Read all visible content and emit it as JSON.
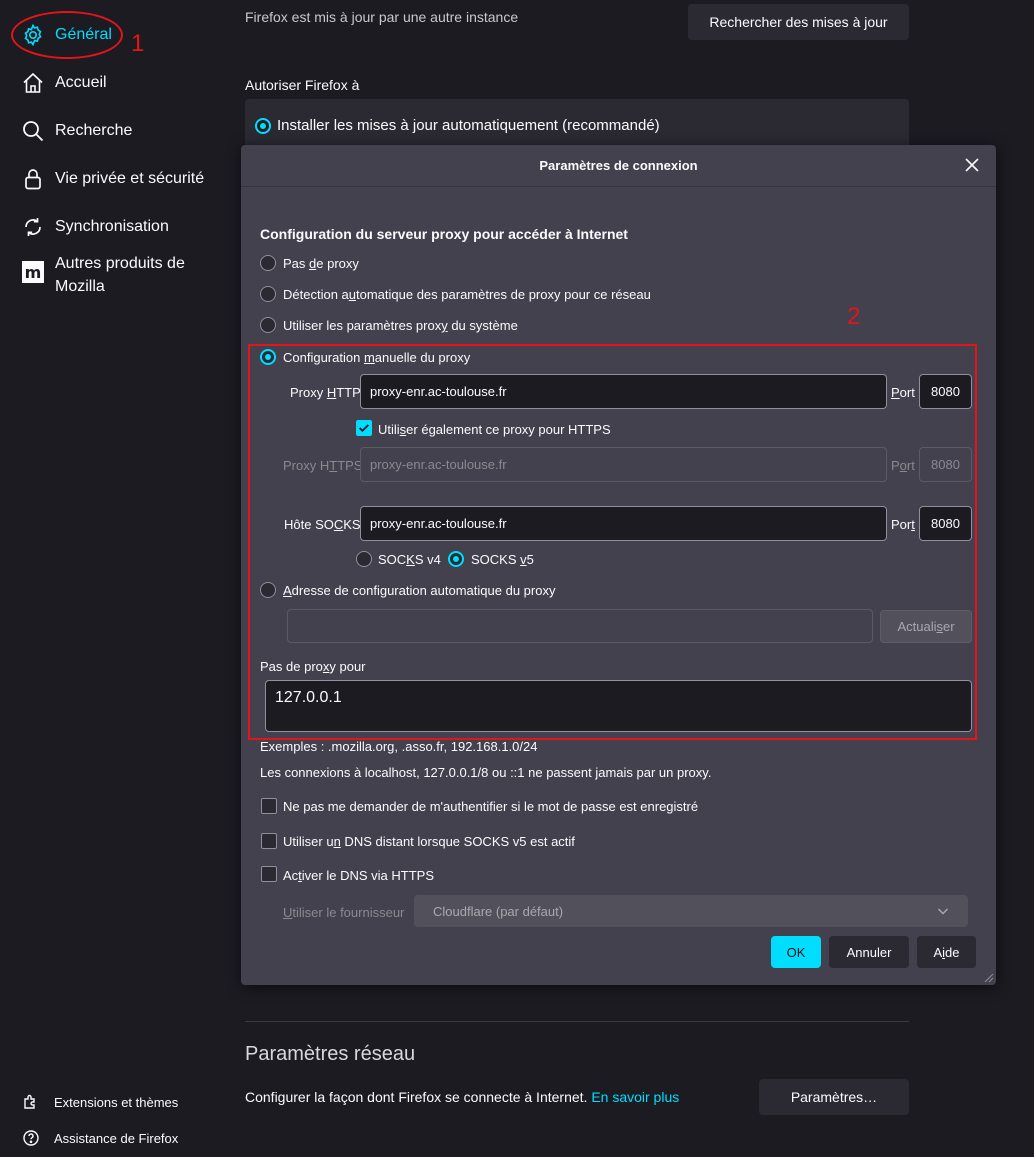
{
  "sidebar": {
    "items": [
      {
        "label": "Général",
        "icon": "gear-icon"
      },
      {
        "label": "Accueil",
        "icon": "home-icon"
      },
      {
        "label": "Recherche",
        "icon": "search-icon"
      },
      {
        "label": "Vie privée et sécurité",
        "icon": "lock-icon"
      },
      {
        "label": "Synchronisation",
        "icon": "sync-icon"
      },
      {
        "label_line1": "Autres produits de",
        "label_line2": "Mozilla",
        "icon": "mozilla-icon"
      }
    ],
    "footer": [
      {
        "label": "Extensions et thèmes",
        "icon": "puzzle-icon"
      },
      {
        "label": "Assistance de Firefox",
        "icon": "help-icon"
      }
    ]
  },
  "annotations": {
    "one": "1",
    "two": "2"
  },
  "background": {
    "update_status": "Firefox est mis à jour par une autre instance",
    "check_updates_button": "Rechercher des mises à jour",
    "allow_label": "Autoriser Firefox à",
    "auto_update_option": "Installer les mises à jour automatiquement (recommandé)",
    "network_title": "Paramètres réseau",
    "network_desc": "Configurer la façon dont Firefox se connecte à Internet.",
    "learn_more": "En savoir plus",
    "settings_button": "Paramètres…"
  },
  "dialog": {
    "title": "Paramètres de connexion",
    "heading": "Configuration du serveur proxy pour accéder à Internet",
    "opt_no_proxy_a": "Pas ",
    "opt_no_proxy_u": "d",
    "opt_no_proxy_b": "e proxy",
    "opt_auto_detect_a": "Détection a",
    "opt_auto_detect_u": "u",
    "opt_auto_detect_b": "tomatique des paramètres de proxy pour ce réseau",
    "opt_system_a": "Utiliser les paramètres prox",
    "opt_system_u": "y",
    "opt_system_b": " du système",
    "opt_manual_a": "Configuration ",
    "opt_manual_u": "m",
    "opt_manual_b": "anuelle du proxy",
    "http_label_a": "Proxy ",
    "http_label_u": "H",
    "http_label_b": "TTP",
    "http_value": "proxy-enr.ac-toulouse.fr",
    "port_a": "",
    "port_u": "P",
    "port_b": "ort",
    "http_port": "8080",
    "also_https_a": "Utili",
    "also_https_u": "s",
    "also_https_b": "er également ce proxy pour HTTPS",
    "https_label_a": "Proxy H",
    "https_label_u": "T",
    "https_label_b": "TPS",
    "https_value": "proxy-enr.ac-toulouse.fr",
    "https_port_a": "P",
    "https_port_u": "o",
    "https_port_b": "rt",
    "https_port": "8080",
    "socks_label_a": "Hôte SO",
    "socks_label_u": "C",
    "socks_label_b": "KS",
    "socks_value": "proxy-enr.ac-toulouse.fr",
    "socks_port_a": "Por",
    "socks_port_u": "t",
    "socks_port_b": "",
    "socks_port": "8080",
    "socks4_a": "SOC",
    "socks4_u": "K",
    "socks4_b": "S v4",
    "socks5_a": "SOCKS ",
    "socks5_u": "v",
    "socks5_b": "5",
    "opt_pac_a": "",
    "opt_pac_u": "A",
    "opt_pac_b": "dresse de configuration automatique du proxy",
    "pac_value": "",
    "reload_a": "Actuali",
    "reload_u": "s",
    "reload_b": "er",
    "no_proxy_label_a": "Pas de pro",
    "no_proxy_label_u": "x",
    "no_proxy_label_b": "y pour",
    "no_proxy_value": "127.0.0.1",
    "examples": "Exemples : .mozilla.org, .asso.fr, 192.168.1.0/24",
    "localhost_note": "Les connexions à localhost, 127.0.0.1/8 ou ::1 ne passent jamais par un proxy.",
    "no_auth_prompt": "Ne pas me demander de m'authentifier si le mot de passe est enregistré",
    "remote_dns_a": "Utiliser u",
    "remote_dns_u": "n",
    "remote_dns_b": " DNS distant lorsque SOCKS v5 est actif",
    "doh_a": "Ac",
    "doh_u": "t",
    "doh_b": "iver le DNS via HTTPS",
    "provider_label_a": "",
    "provider_label_u": "U",
    "provider_label_b": "tiliser le fournisseur",
    "provider_value": "Cloudflare (par défaut)",
    "ok": "OK",
    "cancel": "Annuler",
    "help_a": "A",
    "help_u": "i",
    "help_b": "de"
  },
  "colors": {
    "accent": "#00ddff",
    "annotation": "#e4141b",
    "background": "#1c1b22",
    "dialog": "#42414d"
  }
}
